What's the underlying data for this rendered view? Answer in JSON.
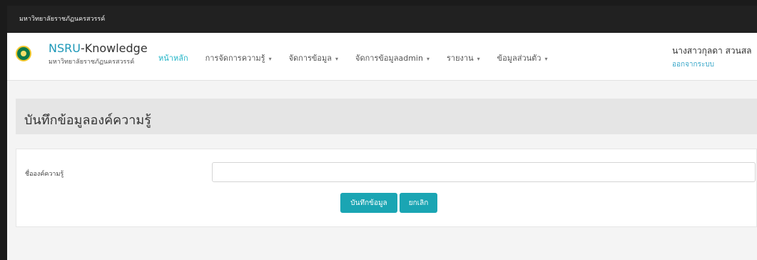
{
  "topbar": {
    "text": "มหาวิทยาลัยราชภัฏนครสวรรค์"
  },
  "brand": {
    "title_accent": "NSRU",
    "title_rest": "-Knowledge",
    "subtitle": "มหาวิทยาลัยราชภัฏนครสวรรค์"
  },
  "menu": {
    "items": [
      {
        "label": "หน้าหลัก",
        "has_caret": false
      },
      {
        "label": "การจัดการความรู้",
        "has_caret": true
      },
      {
        "label": "จัดการข้อมูล",
        "has_caret": true
      },
      {
        "label": "จัดการข้อมูลadmin",
        "has_caret": true
      },
      {
        "label": "รายงาน",
        "has_caret": true
      },
      {
        "label": "ข้อมูลส่วนตัว",
        "has_caret": true
      }
    ],
    "caret": "▾"
  },
  "user": {
    "name": "นางสาวกุลดา สวนสล",
    "logout": "ออกจากระบบ"
  },
  "page": {
    "title": "บันทึกข้อมูลองค์ความรู้"
  },
  "form": {
    "label": "ชื่อองค์ความรู้",
    "input_value": "",
    "save_button": "บันทึกข้อมูล",
    "cancel_button": "ยกเลิก"
  },
  "colors": {
    "accent": "#1aa5b3",
    "active_menu": "#20b4c7",
    "topbar": "#212121"
  }
}
